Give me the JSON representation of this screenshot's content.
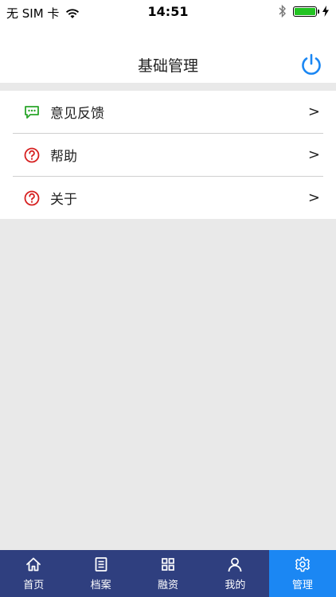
{
  "status_bar": {
    "carrier": "无 SIM 卡",
    "time": "14:51"
  },
  "header": {
    "title": "基础管理",
    "power_icon": "power-icon"
  },
  "menu": {
    "items": [
      {
        "label": "意见反馈",
        "icon": "feedback-icon",
        "arrow": ">"
      },
      {
        "label": "帮助",
        "icon": "help-icon",
        "arrow": ">"
      },
      {
        "label": "关于",
        "icon": "about-icon",
        "arrow": ">"
      }
    ]
  },
  "tabbar": {
    "tabs": [
      {
        "label": "首页",
        "icon": "home-icon"
      },
      {
        "label": "档案",
        "icon": "document-icon"
      },
      {
        "label": "融资",
        "icon": "grid-icon"
      },
      {
        "label": "我的",
        "icon": "person-icon"
      },
      {
        "label": "管理",
        "icon": "gear-icon",
        "active": true
      }
    ]
  },
  "colors": {
    "tab_bar_bg": "#2f3f7f",
    "tab_active_bg": "#1b87f3",
    "power_blue": "#1b87f3",
    "feedback_green": "#2aa52a",
    "help_red": "#d61f1f"
  }
}
